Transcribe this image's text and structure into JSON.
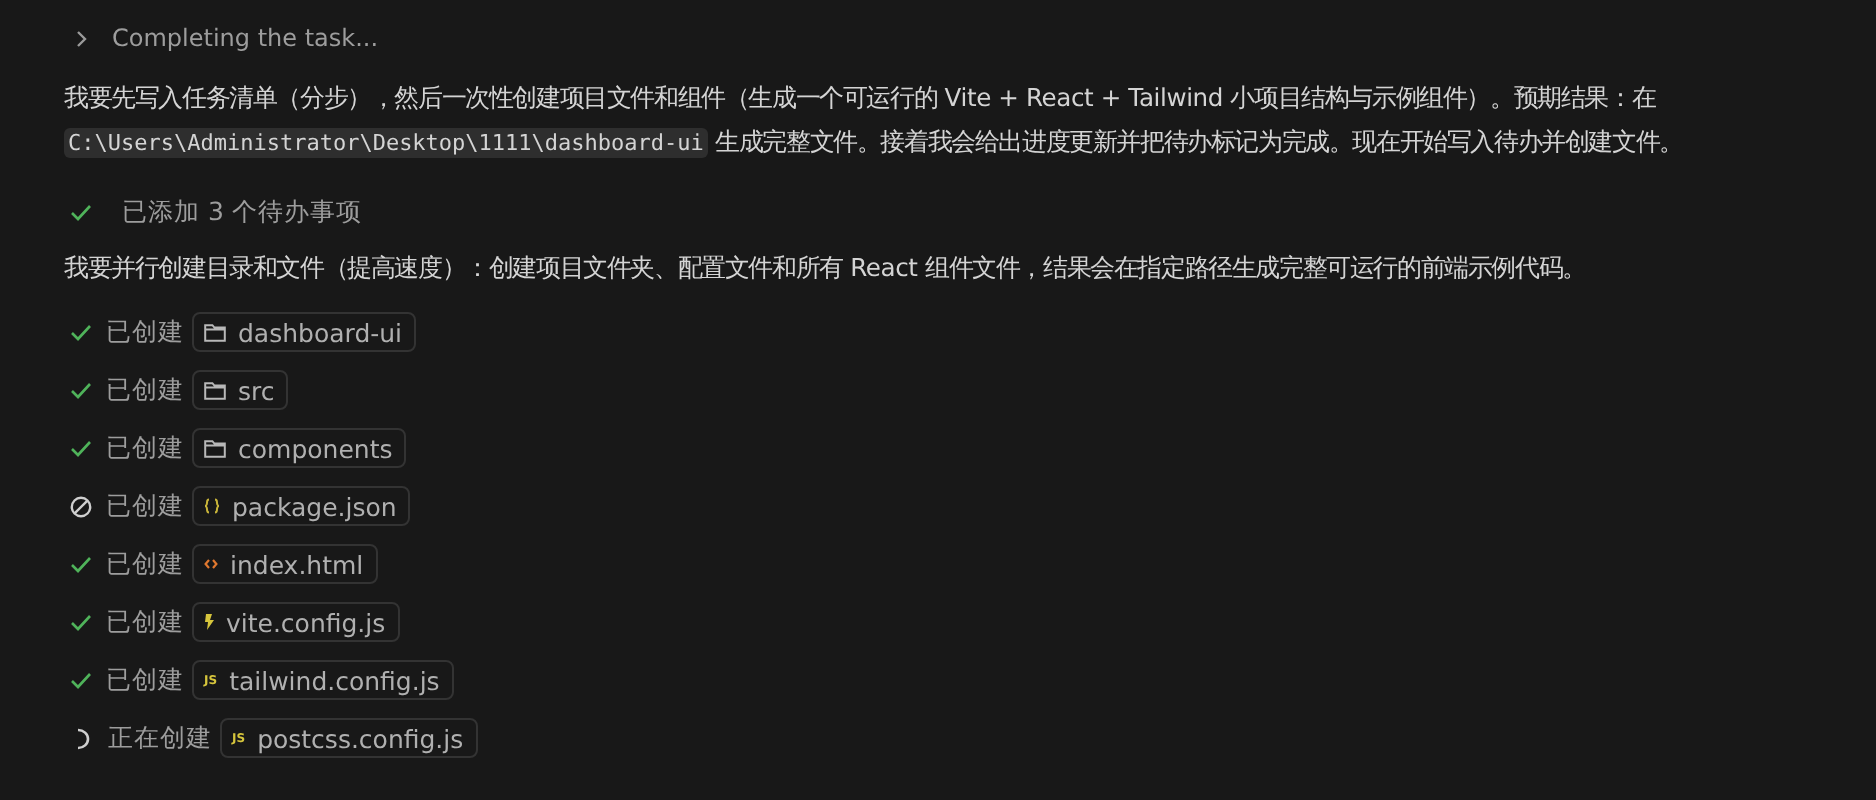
{
  "header": {
    "label": "Completing the task..."
  },
  "intro": {
    "before": "我要先写入任务清单（分步），然后一次性创建项目文件和组件（生成一个可运行的 Vite + React + Tailwind 小项目结构与示例组件）。预期结果：在",
    "code": "C:\\Users\\Administrator\\Desktop\\1111\\dashboard-ui",
    "after": " 生成完整文件。接着我会给出进度更新并把待办标记为完成。现在开始写入待办并创建文件。"
  },
  "todo_note": {
    "kind": "done",
    "label": "已添加 3 个待办事项"
  },
  "plan": "我要并行创建目录和文件（提高速度）：创建项目文件夹、配置文件和所有 React 组件文件，结果会在指定路径生成完整可运行的前端示例代码。",
  "steps": [
    {
      "kind": "done",
      "action": "已创建",
      "file": {
        "kind": "folder",
        "name": "dashboard-ui"
      }
    },
    {
      "kind": "done",
      "action": "已创建",
      "file": {
        "kind": "folder",
        "name": "src"
      }
    },
    {
      "kind": "done",
      "action": "已创建",
      "file": {
        "kind": "folder",
        "name": "components"
      }
    },
    {
      "kind": "cancelled",
      "action": "已创建",
      "file": {
        "kind": "json",
        "name": "package.json"
      }
    },
    {
      "kind": "done",
      "action": "已创建",
      "file": {
        "kind": "html",
        "name": "index.html"
      }
    },
    {
      "kind": "done",
      "action": "已创建",
      "file": {
        "kind": "vite",
        "name": "vite.config.js"
      }
    },
    {
      "kind": "done",
      "action": "已创建",
      "file": {
        "kind": "js",
        "badge": "JS",
        "name": "tailwind.config.js"
      }
    },
    {
      "kind": "progress",
      "action": "正在创建",
      "file": {
        "kind": "js",
        "badge": "JS",
        "name": "postcss.config.js"
      }
    }
  ]
}
